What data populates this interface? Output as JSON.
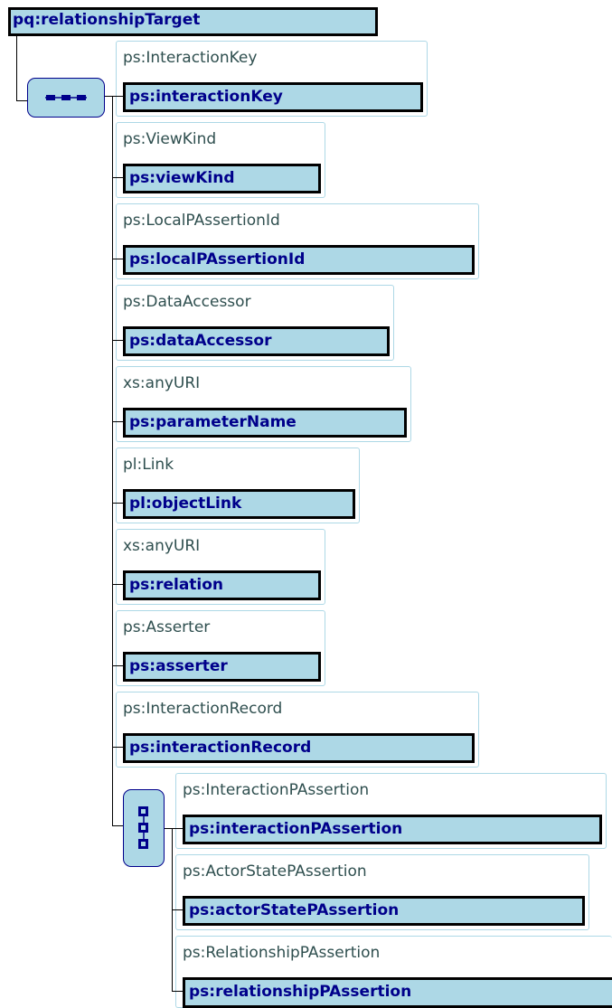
{
  "root": {
    "label": "pq:relationshipTarget"
  },
  "sequence_icon": "sequence-compositor-icon",
  "choice_icon": "choice-compositor-icon",
  "items": [
    {
      "type": "ps:InteractionKey",
      "element": "ps:interactionKey"
    },
    {
      "type": "ps:ViewKind",
      "element": "ps:viewKind"
    },
    {
      "type": "ps:LocalPAssertionId",
      "element": "ps:localPAssertionId"
    },
    {
      "type": "ps:DataAccessor",
      "element": "ps:dataAccessor"
    },
    {
      "type": "xs:anyURI",
      "element": "ps:parameterName"
    },
    {
      "type": "pl:Link",
      "element": "pl:objectLink"
    },
    {
      "type": "xs:anyURI",
      "element": "ps:relation"
    },
    {
      "type": "ps:Asserter",
      "element": "ps:asserter"
    },
    {
      "type": "ps:InteractionRecord",
      "element": "ps:interactionRecord"
    }
  ],
  "choices": [
    {
      "type": "ps:InteractionPAssertion",
      "element": "ps:interactionPAssertion"
    },
    {
      "type": "ps:ActorStatePAssertion",
      "element": "ps:actorStatePAssertion"
    },
    {
      "type": "ps:RelationshipPAssertion",
      "element": "ps:relationshipPAssertion"
    }
  ]
}
